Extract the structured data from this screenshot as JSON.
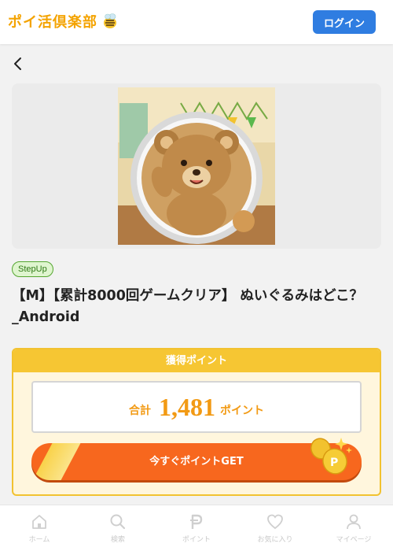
{
  "header": {
    "logo_text": "ポイ活倶楽部",
    "login_label": "ログイン"
  },
  "hero": {
    "image_icon": "teddy-bear-game-icon"
  },
  "offer": {
    "badge": "StepUp",
    "title": "【M】【累計8000回ゲームクリア】 ぬいぐるみはどこ？_Android"
  },
  "points": {
    "header": "獲得ポイント",
    "total_label": "合計",
    "value": "1,481",
    "unit": "ポイント",
    "cta_label": "今すぐポイントGET"
  },
  "bottom_nav": {
    "items": [
      {
        "label": "ホーム",
        "icon": "home-icon"
      },
      {
        "label": "検索",
        "icon": "search-icon"
      },
      {
        "label": "ポイント",
        "icon": "points-icon"
      },
      {
        "label": "お気に入り",
        "icon": "heart-icon"
      },
      {
        "label": "マイページ",
        "icon": "user-icon"
      }
    ]
  },
  "colors": {
    "brand": "#f4a300",
    "login": "#2f7de1",
    "accent_orange": "#f7671e",
    "panel_yellow": "#f6c633",
    "badge_green": "#55a630"
  }
}
